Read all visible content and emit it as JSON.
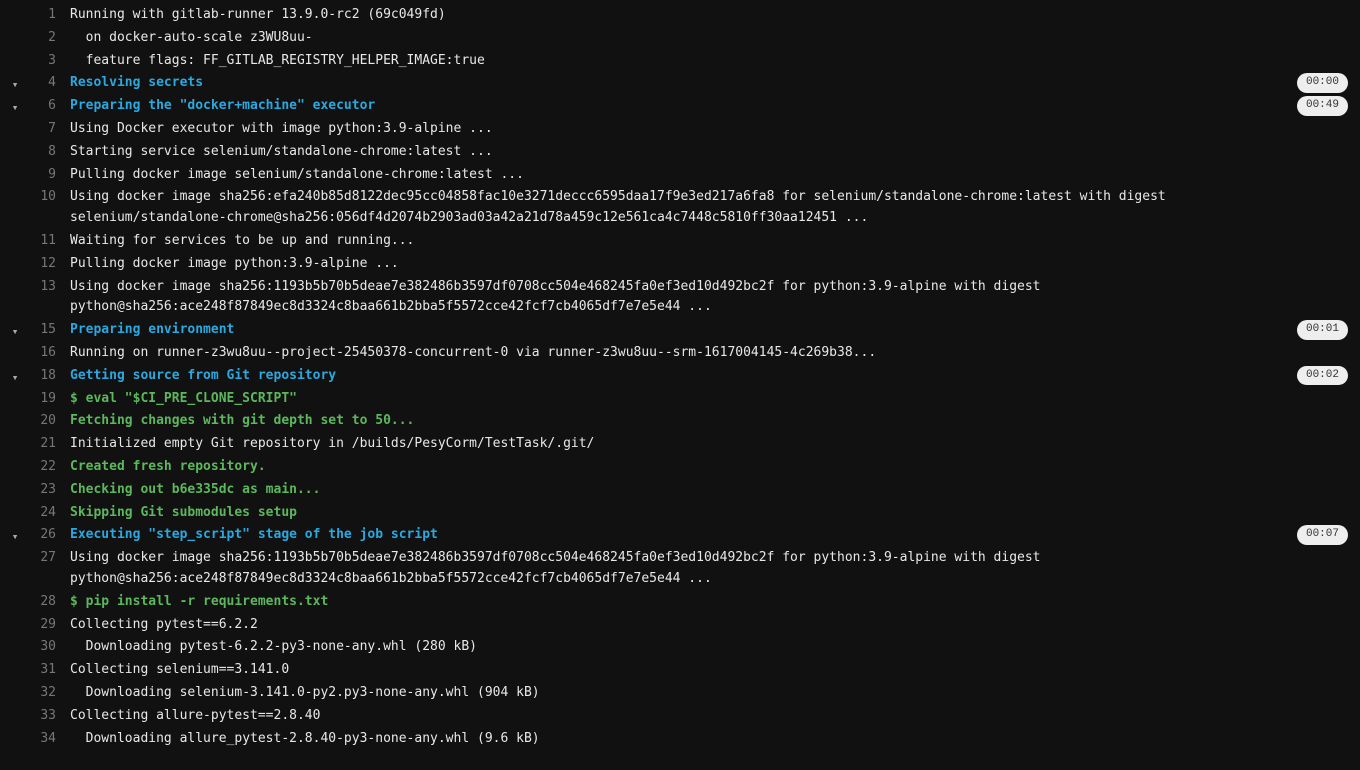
{
  "lines": [
    {
      "n": 1,
      "chevron": false,
      "color": "white",
      "text": "Running with gitlab-runner 13.9.0-rc2 (69c049fd)"
    },
    {
      "n": 2,
      "chevron": false,
      "color": "white",
      "text": "  on docker-auto-scale z3WU8uu-"
    },
    {
      "n": 3,
      "chevron": false,
      "color": "white",
      "text": "  feature flags: FF_GITLAB_REGISTRY_HELPER_IMAGE:true"
    },
    {
      "n": 4,
      "chevron": true,
      "color": "cyan",
      "text": "Resolving secrets",
      "badge": "00:00"
    },
    {
      "n": 6,
      "chevron": true,
      "color": "cyan",
      "text": "Preparing the \"docker+machine\" executor",
      "badge": "00:49"
    },
    {
      "n": 7,
      "chevron": false,
      "color": "white",
      "text": "Using Docker executor with image python:3.9-alpine ..."
    },
    {
      "n": 8,
      "chevron": false,
      "color": "white",
      "text": "Starting service selenium/standalone-chrome:latest ..."
    },
    {
      "n": 9,
      "chevron": false,
      "color": "white",
      "text": "Pulling docker image selenium/standalone-chrome:latest ..."
    },
    {
      "n": 10,
      "chevron": false,
      "color": "white",
      "text": "Using docker image sha256:efa240b85d8122dec95cc04858fac10e3271deccc6595daa17f9e3ed217a6fa8 for selenium/standalone-chrome:latest with digest selenium/standalone-chrome@sha256:056df4d2074b2903ad03a42a21d78a459c12e561ca4c7448c5810ff30aa12451 ..."
    },
    {
      "n": 11,
      "chevron": false,
      "color": "white",
      "text": "Waiting for services to be up and running..."
    },
    {
      "n": 12,
      "chevron": false,
      "color": "white",
      "text": "Pulling docker image python:3.9-alpine ..."
    },
    {
      "n": 13,
      "chevron": false,
      "color": "white",
      "text": "Using docker image sha256:1193b5b70b5deae7e382486b3597df0708cc504e468245fa0ef3ed10d492bc2f for python:3.9-alpine with digest python@sha256:ace248f87849ec8d3324c8baa661b2bba5f5572cce42fcf7cb4065df7e7e5e44 ..."
    },
    {
      "n": 15,
      "chevron": true,
      "color": "cyan",
      "text": "Preparing environment",
      "badge": "00:01"
    },
    {
      "n": 16,
      "chevron": false,
      "color": "white",
      "text": "Running on runner-z3wu8uu--project-25450378-concurrent-0 via runner-z3wu8uu--srm-1617004145-4c269b38..."
    },
    {
      "n": 18,
      "chevron": true,
      "color": "cyan",
      "text": "Getting source from Git repository",
      "badge": "00:02"
    },
    {
      "n": 19,
      "chevron": false,
      "color": "green",
      "text": "$ eval \"$CI_PRE_CLONE_SCRIPT\""
    },
    {
      "n": 20,
      "chevron": false,
      "color": "green",
      "text": "Fetching changes with git depth set to 50..."
    },
    {
      "n": 21,
      "chevron": false,
      "color": "white",
      "text": "Initialized empty Git repository in /builds/PesyCorm/TestTask/.git/"
    },
    {
      "n": 22,
      "chevron": false,
      "color": "green",
      "text": "Created fresh repository."
    },
    {
      "n": 23,
      "chevron": false,
      "color": "green",
      "text": "Checking out b6e335dc as main..."
    },
    {
      "n": 24,
      "chevron": false,
      "color": "green",
      "text": "Skipping Git submodules setup"
    },
    {
      "n": 26,
      "chevron": true,
      "color": "cyan",
      "text": "Executing \"step_script\" stage of the job script",
      "badge": "00:07"
    },
    {
      "n": 27,
      "chevron": false,
      "color": "white",
      "text": "Using docker image sha256:1193b5b70b5deae7e382486b3597df0708cc504e468245fa0ef3ed10d492bc2f for python:3.9-alpine with digest python@sha256:ace248f87849ec8d3324c8baa661b2bba5f5572cce42fcf7cb4065df7e7e5e44 ..."
    },
    {
      "n": 28,
      "chevron": false,
      "color": "green",
      "text": "$ pip install -r requirements.txt"
    },
    {
      "n": 29,
      "chevron": false,
      "color": "white",
      "text": "Collecting pytest==6.2.2"
    },
    {
      "n": 30,
      "chevron": false,
      "color": "white",
      "text": "  Downloading pytest-6.2.2-py3-none-any.whl (280 kB)"
    },
    {
      "n": 31,
      "chevron": false,
      "color": "white",
      "text": "Collecting selenium==3.141.0"
    },
    {
      "n": 32,
      "chevron": false,
      "color": "white",
      "text": "  Downloading selenium-3.141.0-py2.py3-none-any.whl (904 kB)"
    },
    {
      "n": 33,
      "chevron": false,
      "color": "white",
      "text": "Collecting allure-pytest==2.8.40"
    },
    {
      "n": 34,
      "chevron": false,
      "color": "white",
      "text": "  Downloading allure_pytest-2.8.40-py3-none-any.whl (9.6 kB)"
    }
  ]
}
